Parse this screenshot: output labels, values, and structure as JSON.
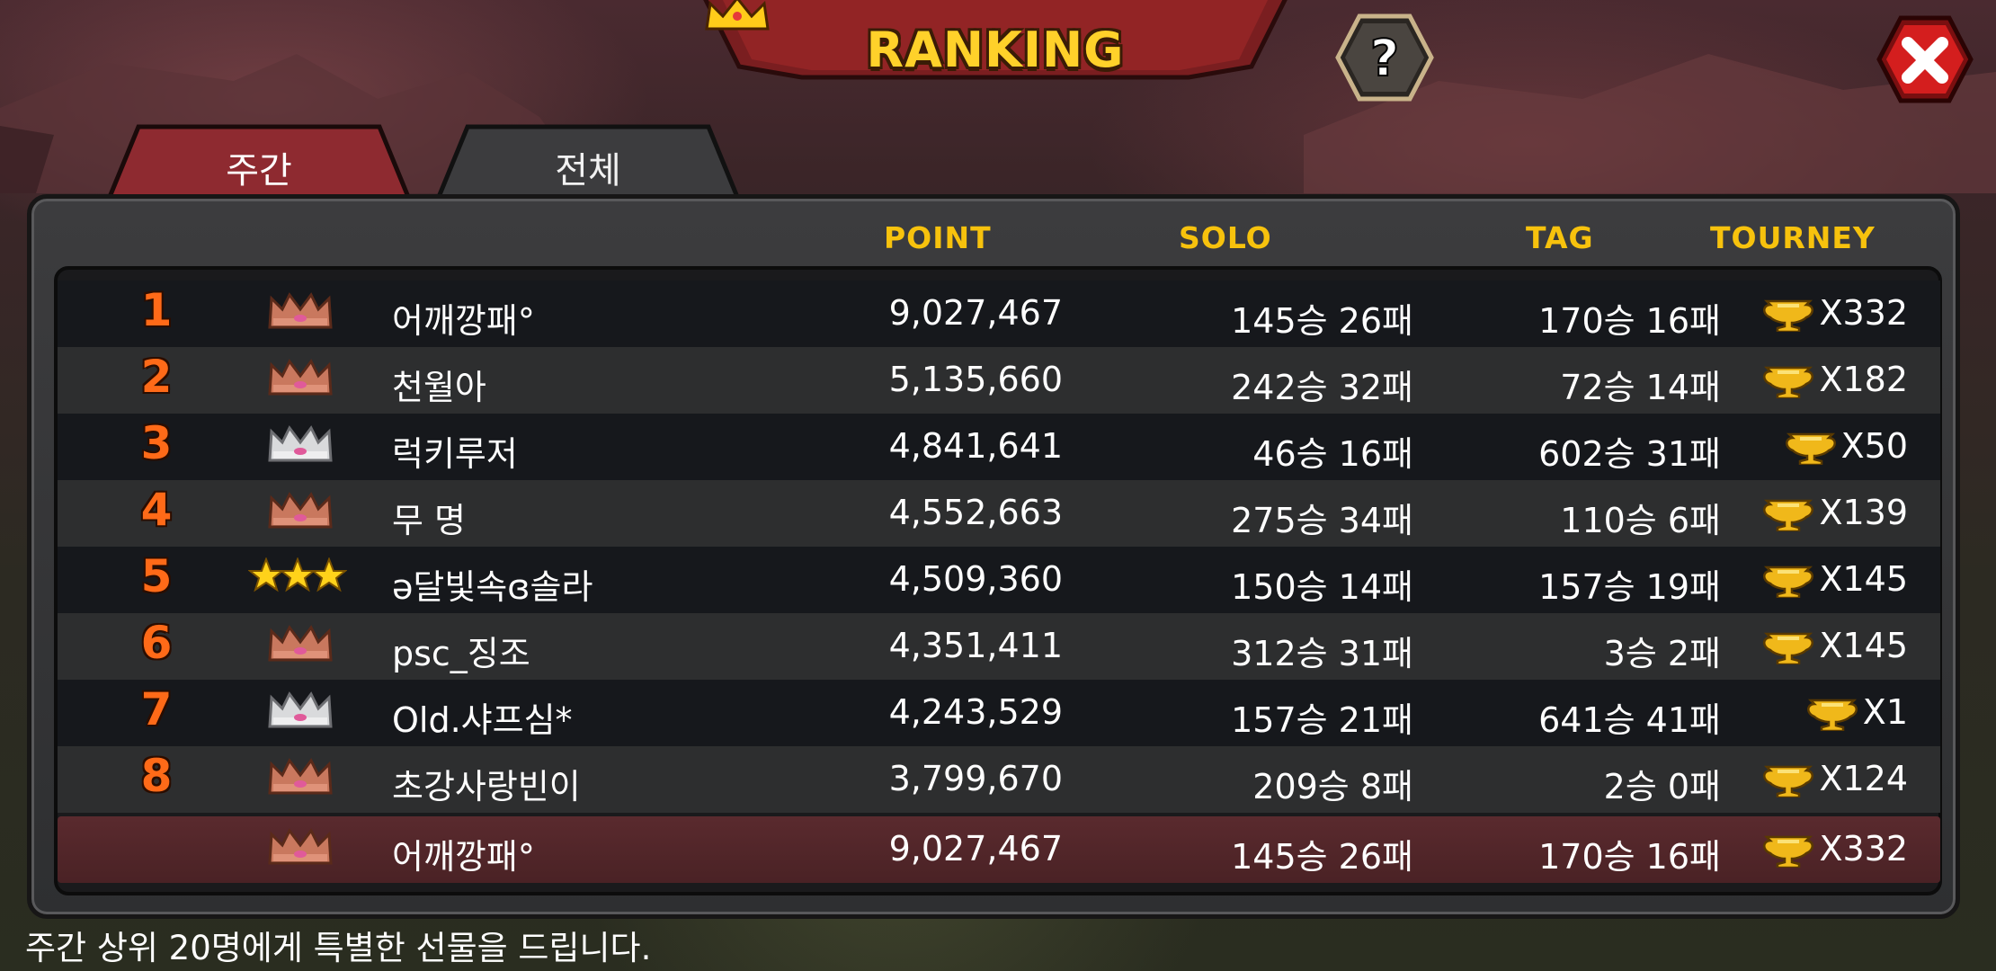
{
  "header": {
    "title": "RANKING"
  },
  "tabs": [
    {
      "label": "주간",
      "active": false
    },
    {
      "label": "전체",
      "active": true
    }
  ],
  "columns": {
    "point": "POINT",
    "solo": "SOLO",
    "tag": "TAG",
    "tourney": "TOURNEY"
  },
  "rows": [
    {
      "rank": "1",
      "badge": "bronze-crown",
      "name": "어깨깡패°",
      "points": "9,027,467",
      "solo": "145승 26패",
      "tag": "170승 16패",
      "tourney": "X332"
    },
    {
      "rank": "2",
      "badge": "bronze-crown",
      "name": "천월아",
      "points": "5,135,660",
      "solo": "242승 32패",
      "tag": "72승 14패",
      "tourney": "X182"
    },
    {
      "rank": "3",
      "badge": "silver-crown",
      "name": "럭키루저",
      "points": "4,841,641",
      "solo": "46승 16패",
      "tag": "602승 31패",
      "tourney": "X50"
    },
    {
      "rank": "4",
      "badge": "bronze-crown",
      "name": "무 명",
      "points": "4,552,663",
      "solo": "275승 34패",
      "tag": "110승 6패",
      "tourney": "X139"
    },
    {
      "rank": "5",
      "badge": "three-stars",
      "name": "ə달빛속ɞ솔라",
      "points": "4,509,360",
      "solo": "150승 14패",
      "tag": "157승 19패",
      "tourney": "X145"
    },
    {
      "rank": "6",
      "badge": "bronze-crown",
      "name": "psc_징조",
      "points": "4,351,411",
      "solo": "312승 31패",
      "tag": "3승 2패",
      "tourney": "X145"
    },
    {
      "rank": "7",
      "badge": "silver-crown",
      "name": "Old.샤프심*",
      "points": "4,243,529",
      "solo": "157승 21패",
      "tag": "641승 41패",
      "tourney": "X1"
    },
    {
      "rank": "8",
      "badge": "bronze-crown",
      "name": "초강사랑빈이",
      "points": "3,799,670",
      "solo": "209승 8패",
      "tag": "2승 0패",
      "tourney": "X124"
    }
  ],
  "my_row": {
    "rank": "",
    "badge": "bronze-crown",
    "name": "어깨깡패°",
    "points": "9,027,467",
    "solo": "145승 26패",
    "tag": "170승 16패",
    "tourney": "X332"
  },
  "footer": {
    "note": "주간 상위 20명에게 특별한 선물을 드립니다."
  },
  "colors": {
    "accent_gold": "#f7c20d",
    "rank_orange": "#ff6a18",
    "tab_red": "#8e2a30",
    "my_row": "#5a2a2e"
  }
}
